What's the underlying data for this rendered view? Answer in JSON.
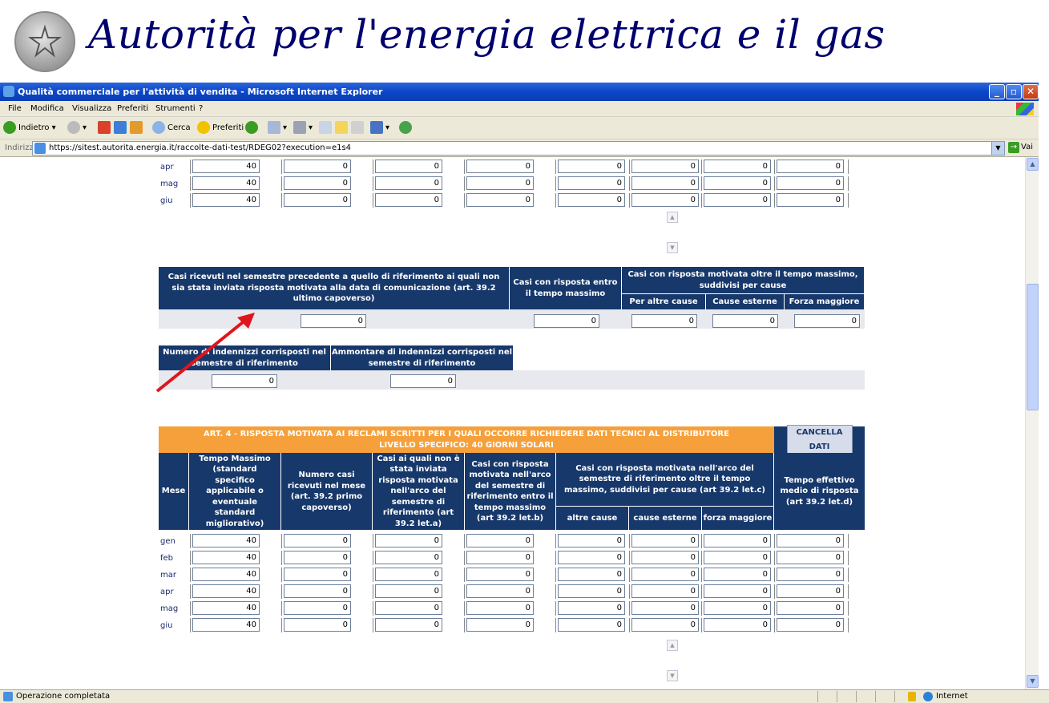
{
  "banner": {
    "title": "Autorità per l'energia elettrica e il gas"
  },
  "window": {
    "title": "Qualità commerciale per l'attività di vendita - Microsoft Internet Explorer"
  },
  "menu": [
    "File",
    "Modifica",
    "Visualizza",
    "Preferiti",
    "Strumenti",
    "?"
  ],
  "toolbar": {
    "back": "Indietro",
    "search": "Cerca",
    "favorites": "Preferiti"
  },
  "address": {
    "label": "Indirizzo",
    "url": "https://sitest.autorita.energia.it/raccolte-dati-test/RDEG02?execution=e1s4",
    "go": "Vai"
  },
  "top_table": {
    "rows": [
      {
        "month": "apr",
        "values": [
          "40",
          "0",
          "0",
          "0",
          "0",
          "0",
          "0",
          "0"
        ]
      },
      {
        "month": "mag",
        "values": [
          "40",
          "0",
          "0",
          "0",
          "0",
          "0",
          "0",
          "0"
        ]
      },
      {
        "month": "giu",
        "values": [
          "40",
          "0",
          "0",
          "0",
          "0",
          "0",
          "0",
          "0"
        ]
      }
    ]
  },
  "semester_table": {
    "h1": "Casi ricevuti nel semestre precedente a quello di riferimento ai quali non sia stata inviata risposta motivata alla data di comunicazione (art. 39.2 ultimo capoverso)",
    "h2": "Casi con risposta entro il tempo massimo",
    "h3": "Casi con risposta motivata oltre il tempo massimo, suddivisi per cause",
    "h3a": "Per altre cause",
    "h3b": "Cause esterne",
    "h3c": "Forza maggiore",
    "values": [
      "0",
      "0",
      "0",
      "0",
      "0"
    ]
  },
  "indennizzi_table": {
    "h1": "Numero di indennizzi corrisposti nel semestre di riferimento",
    "h2": "Ammontare di indennizzi corrisposti nel semestre di riferimento",
    "values": [
      "0",
      "0"
    ]
  },
  "art4": {
    "title_line1": "ART. 4 - RISPOSTA MOTIVATA AI RECLAMI SCRITTI PER I QUALI OCCORRE RICHIEDERE DATI TECNICI AL DISTRIBUTORE",
    "title_line2": "LIVELLO SPECIFICO: 40 GIORNI SOLARI",
    "cancel": "CANCELLA DATI",
    "headers": {
      "mese": "Mese",
      "tempo_massimo": "Tempo Massimo (standard specifico applicabile o eventuale standard migliorativo)",
      "numero_casi": "Numero casi ricevuti nel mese (art. 39.2 primo capoverso)",
      "non_inviata": "Casi ai quali non è stata inviata risposta motivata nell'arco del semestre di riferimento (art 39.2 let.a)",
      "entro": "Casi con risposta motivata nell'arco del semestre di riferimento entro il tempo massimo (art 39.2 let.b)",
      "oltre": "Casi con risposta motivata nell'arco del semestre di riferimento oltre il tempo massimo, suddivisi per cause (art 39.2 let.c)",
      "altre": "altre cause",
      "esterne": "cause esterne",
      "forza": "forza maggiore",
      "tempo_effettivo": "Tempo effettivo medio di risposta (art 39.2 let.d)"
    },
    "rows": [
      {
        "month": "gen",
        "values": [
          "40",
          "0",
          "0",
          "0",
          "0",
          "0",
          "0",
          "0"
        ]
      },
      {
        "month": "feb",
        "values": [
          "40",
          "0",
          "0",
          "0",
          "0",
          "0",
          "0",
          "0"
        ]
      },
      {
        "month": "mar",
        "values": [
          "40",
          "0",
          "0",
          "0",
          "0",
          "0",
          "0",
          "0"
        ]
      },
      {
        "month": "apr",
        "values": [
          "40",
          "0",
          "0",
          "0",
          "0",
          "0",
          "0",
          "0"
        ]
      },
      {
        "month": "mag",
        "values": [
          "40",
          "0",
          "0",
          "0",
          "0",
          "0",
          "0",
          "0"
        ]
      },
      {
        "month": "giu",
        "values": [
          "40",
          "0",
          "0",
          "0",
          "0",
          "0",
          "0",
          "0"
        ]
      }
    ]
  },
  "status": {
    "text": "Operazione completata",
    "zone": "Internet"
  },
  "colors": {
    "header_blue": "#17386b",
    "orange": "#f5a03a",
    "arrow_red": "#e0141c"
  }
}
